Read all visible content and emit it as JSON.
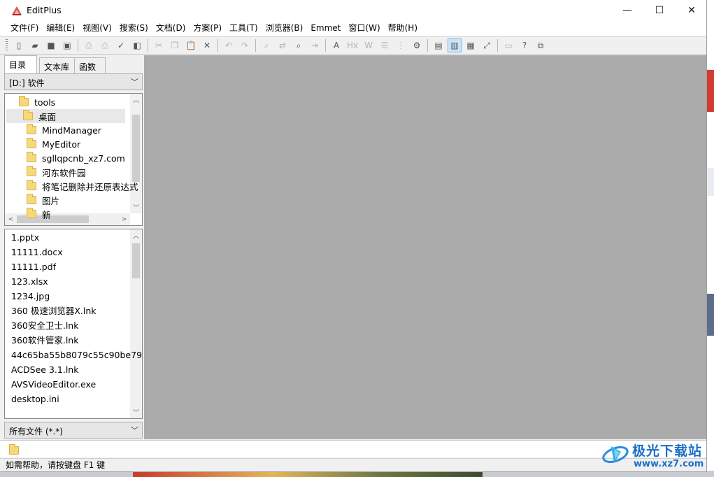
{
  "window": {
    "title": "EditPlus"
  },
  "window_buttons": {
    "minimize": "—",
    "maximize": "☐",
    "close": "✕"
  },
  "menu": [
    "文件(F)",
    "编辑(E)",
    "视图(V)",
    "搜索(S)",
    "文档(D)",
    "方案(P)",
    "工具(T)",
    "浏览器(B)",
    "Emmet",
    "窗口(W)",
    "帮助(H)"
  ],
  "toolbar": {
    "buttons": [
      {
        "icon": "new-file-icon",
        "glyph": "▯",
        "state": "normal"
      },
      {
        "icon": "open-folder-icon",
        "glyph": "▰",
        "state": "normal"
      },
      {
        "icon": "save-icon",
        "glyph": "■",
        "state": "normal"
      },
      {
        "icon": "save-all-icon",
        "glyph": "▣",
        "state": "normal"
      },
      {
        "sep": true
      },
      {
        "icon": "print-preview-icon",
        "glyph": "⎙",
        "state": "disabled"
      },
      {
        "icon": "print-icon",
        "glyph": "⎙",
        "state": "disabled"
      },
      {
        "icon": "spell-check-icon",
        "glyph": "✓",
        "state": "normal"
      },
      {
        "icon": "browser-view-icon",
        "glyph": "◧",
        "state": "normal"
      },
      {
        "sep": true
      },
      {
        "icon": "cut-icon",
        "glyph": "✂",
        "state": "disabled"
      },
      {
        "icon": "copy-icon",
        "glyph": "❐",
        "state": "disabled"
      },
      {
        "icon": "paste-icon",
        "glyph": "📋",
        "state": "normal"
      },
      {
        "icon": "delete-icon",
        "glyph": "✕",
        "state": "normal"
      },
      {
        "sep": true
      },
      {
        "icon": "undo-icon",
        "glyph": "↶",
        "state": "disabled"
      },
      {
        "icon": "redo-icon",
        "glyph": "↷",
        "state": "disabled"
      },
      {
        "sep": true
      },
      {
        "icon": "find-icon",
        "glyph": "⌕",
        "state": "disabled"
      },
      {
        "icon": "replace-icon",
        "glyph": "⇄",
        "state": "disabled"
      },
      {
        "icon": "find-in-files-icon",
        "glyph": "⌕",
        "state": "normal"
      },
      {
        "icon": "goto-line-icon",
        "glyph": "⇥",
        "state": "disabled"
      },
      {
        "sep": true
      },
      {
        "icon": "font-icon",
        "glyph": "A",
        "state": "normal"
      },
      {
        "icon": "hex-view-icon",
        "glyph": "Hx",
        "state": "disabled"
      },
      {
        "icon": "word-wrap-icon",
        "glyph": "W",
        "state": "disabled"
      },
      {
        "icon": "ruler-icon",
        "glyph": "☰",
        "state": "disabled"
      },
      {
        "icon": "line-number-icon",
        "glyph": "⋮",
        "state": "disabled"
      },
      {
        "icon": "preferences-icon",
        "glyph": "⚙",
        "state": "normal"
      },
      {
        "sep": true
      },
      {
        "icon": "directory-window-icon",
        "glyph": "▤",
        "state": "normal"
      },
      {
        "icon": "cliptext-window-icon",
        "glyph": "▥",
        "state": "active"
      },
      {
        "icon": "output-window-icon",
        "glyph": "▦",
        "state": "normal"
      },
      {
        "icon": "full-screen-icon",
        "glyph": "⤢",
        "state": "normal"
      },
      {
        "sep": true
      },
      {
        "icon": "ftp-icon",
        "glyph": "▭",
        "state": "disabled"
      },
      {
        "icon": "help-icon",
        "glyph": "?",
        "state": "normal"
      },
      {
        "icon": "switch-window-icon",
        "glyph": "⧉",
        "state": "normal"
      }
    ]
  },
  "sidebar": {
    "tabs": [
      "目录",
      "文本库",
      "函数"
    ],
    "drive": "[D:] 软件",
    "tree": [
      {
        "label": "tools",
        "level": 1,
        "selected": false
      },
      {
        "label": "桌面",
        "level": 1,
        "selected": true
      },
      {
        "label": "MindManager",
        "level": 2,
        "selected": false
      },
      {
        "label": "MyEditor",
        "level": 2,
        "selected": false
      },
      {
        "label": "sgllqpcnb_xz7.com",
        "level": 2,
        "selected": false
      },
      {
        "label": "河东软件园",
        "level": 2,
        "selected": false
      },
      {
        "label": "将笔记删除并还原表达式",
        "level": 2,
        "selected": false
      },
      {
        "label": "图片",
        "level": 2,
        "selected": false
      },
      {
        "label": "新",
        "level": 2,
        "selected": false
      }
    ],
    "files": [
      "1.pptx",
      "11111.docx",
      "11111.pdf",
      "123.xlsx",
      "1234.jpg",
      "360 极速浏览器X.lnk",
      "360安全卫士.lnk",
      "360软件管家.lnk",
      "44c65ba55b8079c55c90be79",
      "ACDSee 3.1.lnk",
      "AVSVideoEditor.exe",
      "desktop.ini"
    ],
    "filter": "所有文件 (*.*)"
  },
  "status": {
    "text": "如需帮助，请按键盘 F1 键"
  },
  "watermark": {
    "name": "极光下载站",
    "url": "www.xz7.com"
  },
  "colors": {
    "editor_bg": "#ababab",
    "accent": "#1a6fc8",
    "folder": "#f6d97a"
  }
}
